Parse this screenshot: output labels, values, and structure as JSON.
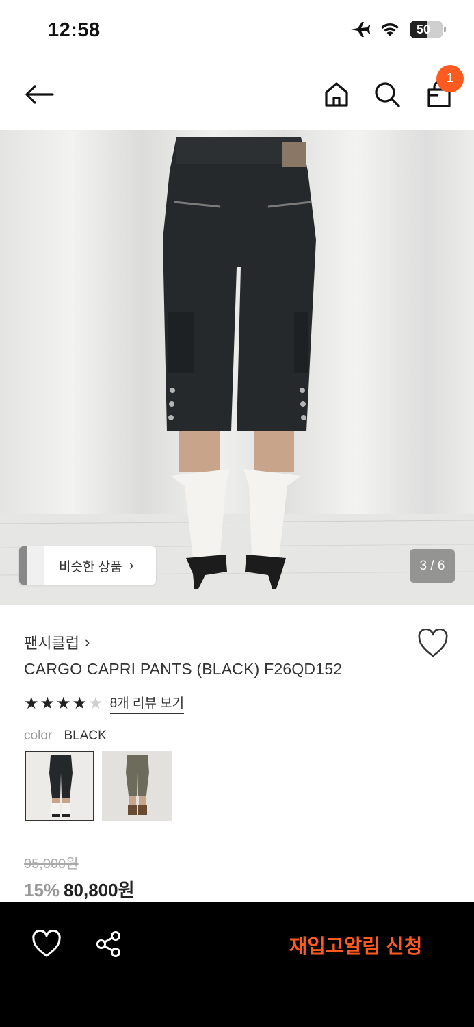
{
  "status": {
    "time": "12:58",
    "battery": "50"
  },
  "nav": {
    "cart_count": "1"
  },
  "gallery": {
    "similar_label": "비슷한 상품",
    "similar_arrow": "›",
    "page": "3 / 6"
  },
  "product": {
    "brand": "팬시클럽",
    "brand_arrow": "›",
    "name": "CARGO CAPRI PANTS (BLACK) F26QD152",
    "rating": 4,
    "rating_max": 5,
    "review_link": "8개 리뷰 보기",
    "color_label": "color",
    "color_value": "BLACK",
    "original_price": "95,000원",
    "discount": "15%",
    "sale_price": "80,800원"
  },
  "bottom": {
    "restock_label": "재입고알림 신청"
  },
  "colors": {
    "accent": "#ff5a1f",
    "bottom_bar": "#000000"
  }
}
